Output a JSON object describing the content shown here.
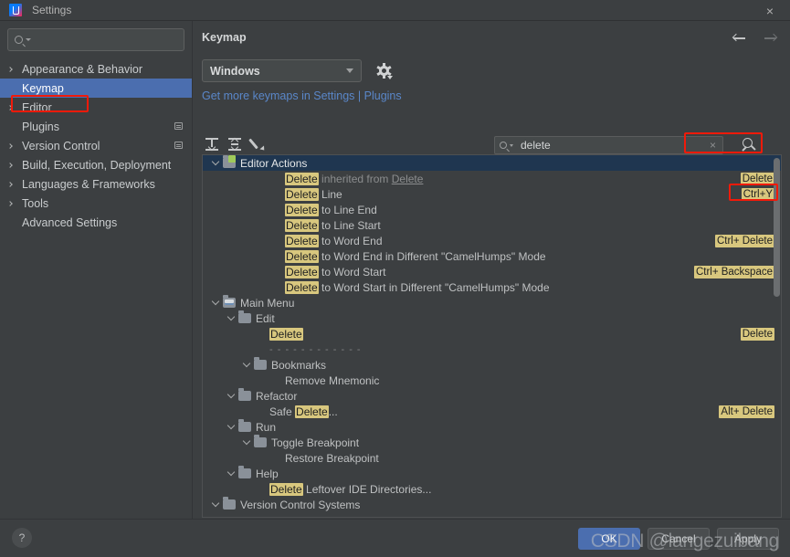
{
  "window": {
    "title": "Settings",
    "app_icon": "intellij-idea-icon",
    "close_label": "×"
  },
  "sidebar": {
    "search_placeholder": "",
    "items": [
      {
        "label": "Appearance & Behavior",
        "expandable": true,
        "selected": false,
        "badge": false
      },
      {
        "label": "Keymap",
        "expandable": false,
        "selected": true,
        "badge": false
      },
      {
        "label": "Editor",
        "expandable": true,
        "selected": false,
        "badge": false
      },
      {
        "label": "Plugins",
        "expandable": false,
        "selected": false,
        "badge": true
      },
      {
        "label": "Version Control",
        "expandable": true,
        "selected": false,
        "badge": true
      },
      {
        "label": "Build, Execution, Deployment",
        "expandable": true,
        "selected": false,
        "badge": false
      },
      {
        "label": "Languages & Frameworks",
        "expandable": true,
        "selected": false,
        "badge": false
      },
      {
        "label": "Tools",
        "expandable": true,
        "selected": false,
        "badge": false
      },
      {
        "label": "Advanced Settings",
        "expandable": false,
        "selected": false,
        "badge": false
      }
    ]
  },
  "main": {
    "title": "Keymap",
    "keymap_select": {
      "value": "Windows"
    },
    "gear_tooltip": "",
    "link_text": "Get more keymaps in Settings | Plugins",
    "toolbar": {
      "expand_all": "expand-all-icon",
      "collapse_all": "collapse-all-icon",
      "edit_shortcut": "edit-pencil-icon"
    },
    "find": {
      "value": "delete",
      "clear_label": "×",
      "shortcut_search_icon": "find-by-shortcut-icon"
    },
    "nav": {
      "back": "←",
      "forward": "→"
    }
  },
  "tree": {
    "rows": [
      {
        "indent": 0,
        "chevron": true,
        "icon": "folder-green",
        "selected": true,
        "text": "Editor Actions",
        "shortcut": ""
      },
      {
        "indent": 4,
        "chevron": false,
        "icon": "",
        "hl": "Delete",
        "after": " inherited from ",
        "link": "Delete",
        "shortcut": "Delete"
      },
      {
        "indent": 4,
        "chevron": false,
        "icon": "",
        "hl": "Delete",
        "after": " Line",
        "shortcut": "Ctrl+Y"
      },
      {
        "indent": 4,
        "chevron": false,
        "icon": "",
        "hl": "Delete",
        "after": " to Line End",
        "shortcut": ""
      },
      {
        "indent": 4,
        "chevron": false,
        "icon": "",
        "hl": "Delete",
        "after": " to Line Start",
        "shortcut": ""
      },
      {
        "indent": 4,
        "chevron": false,
        "icon": "",
        "hl": "Delete",
        "after": " to Word End",
        "shortcut": "Ctrl+ Delete"
      },
      {
        "indent": 4,
        "chevron": false,
        "icon": "",
        "hl": "Delete",
        "after": " to Word End in Different \"CamelHumps\" Mode",
        "shortcut": ""
      },
      {
        "indent": 4,
        "chevron": false,
        "icon": "",
        "hl": "Delete",
        "after": " to Word Start",
        "shortcut": "Ctrl+ Backspace"
      },
      {
        "indent": 4,
        "chevron": false,
        "icon": "",
        "hl": "Delete",
        "after": " to Word Start in Different \"CamelHumps\" Mode",
        "shortcut": ""
      },
      {
        "indent": 0,
        "chevron": true,
        "icon": "folder-menu",
        "text": "Main Menu",
        "shortcut": ""
      },
      {
        "indent": 1,
        "chevron": true,
        "icon": "folder",
        "text": "Edit",
        "shortcut": ""
      },
      {
        "indent": 3,
        "chevron": false,
        "icon": "",
        "hl": "Delete",
        "after": "",
        "shortcut": "Delete"
      },
      {
        "indent": 3,
        "chevron": false,
        "icon": "",
        "separator": true,
        "text": "- - - - - - - - - - - -",
        "shortcut": ""
      },
      {
        "indent": 2,
        "chevron": true,
        "icon": "folder",
        "text": "Bookmarks",
        "shortcut": ""
      },
      {
        "indent": 4,
        "chevron": false,
        "icon": "",
        "text": "Remove Mnemonic",
        "shortcut": ""
      },
      {
        "indent": 1,
        "chevron": true,
        "icon": "folder",
        "text": "Refactor",
        "shortcut": ""
      },
      {
        "indent": 3,
        "chevron": false,
        "icon": "",
        "before": "Safe ",
        "hl": "Delete",
        "after": "...",
        "shortcut": "Alt+ Delete"
      },
      {
        "indent": 1,
        "chevron": true,
        "icon": "folder",
        "text": "Run",
        "shortcut": ""
      },
      {
        "indent": 2,
        "chevron": true,
        "icon": "folder",
        "text": "Toggle Breakpoint",
        "shortcut": ""
      },
      {
        "indent": 4,
        "chevron": false,
        "icon": "",
        "text": "Restore Breakpoint",
        "shortcut": ""
      },
      {
        "indent": 1,
        "chevron": true,
        "icon": "folder",
        "text": "Help",
        "shortcut": ""
      },
      {
        "indent": 3,
        "chevron": false,
        "icon": "",
        "hl": "Delete",
        "after": " Leftover IDE Directories...",
        "shortcut": ""
      },
      {
        "indent": 0,
        "chevron": true,
        "icon": "folder",
        "text": "Version Control Systems",
        "shortcut": ""
      }
    ]
  },
  "bottom": {
    "help_label": "?",
    "ok_label": "OK",
    "cancel_label": "Cancel",
    "apply_label": "Apply",
    "watermark": "CSDN @langezuibang"
  },
  "annotations": {
    "highlight_color": "#f11a0a",
    "boxes": [
      "keymap-sidebar-item",
      "search-field",
      "ctrl-y-shortcut"
    ]
  },
  "colors": {
    "accent": "#4b6eaf",
    "highlight_badge": "#d8c77e",
    "link": "#5a87c9",
    "selected_row": "#1f3650",
    "panel_bg": "#3c3f41"
  }
}
